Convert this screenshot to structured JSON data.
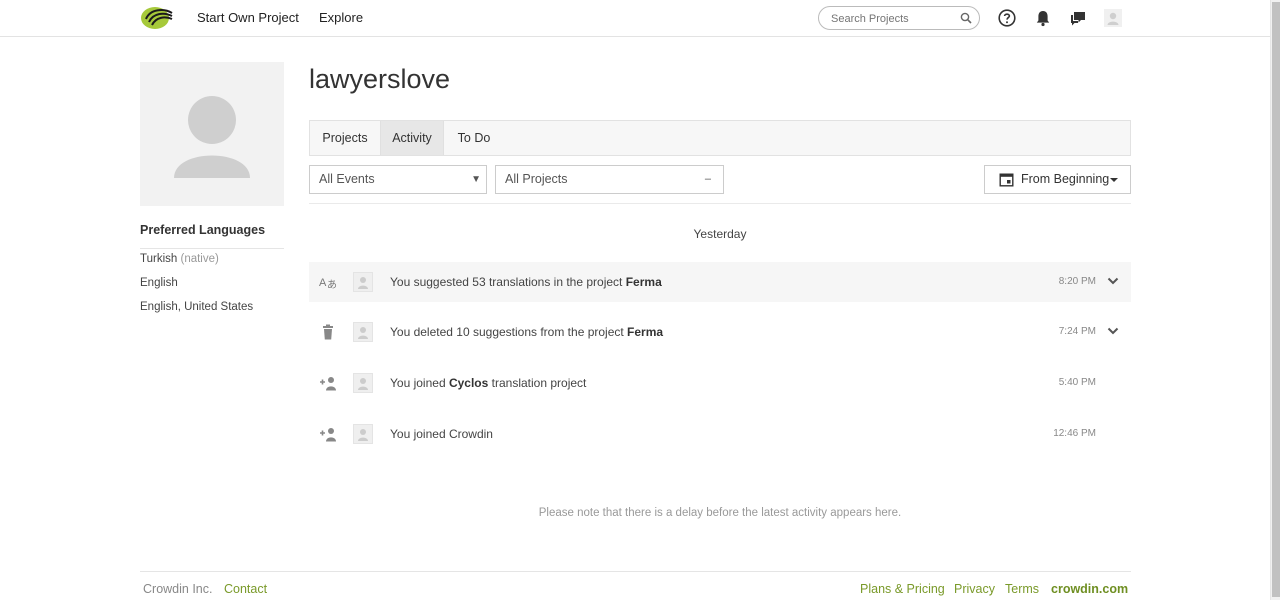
{
  "nav": {
    "start_project": "Start Own Project",
    "explore": "Explore",
    "search_placeholder": "Search Projects"
  },
  "icons": {
    "logo": "crowdin-logo",
    "search": "search-icon",
    "help": "help-icon",
    "notifications": "bell-icon",
    "messages": "chat-icon",
    "user": "user-avatar-icon"
  },
  "colors": {
    "brand_green": "#7a9a2a",
    "logo_green": "#a6c93a"
  },
  "profile": {
    "username": "lawyerslove",
    "preferred_languages_title": "Preferred Languages",
    "languages": [
      {
        "name": "Turkish",
        "note": "(native)"
      },
      {
        "name": "English",
        "note": ""
      },
      {
        "name": "English, United States",
        "note": ""
      }
    ]
  },
  "tabs": [
    {
      "label": "Projects"
    },
    {
      "label": "Activity"
    },
    {
      "label": "To Do"
    }
  ],
  "filters": {
    "events": "All Events",
    "projects": "All Projects",
    "date": "From Beginning"
  },
  "activity": {
    "day_label": "Yesterday",
    "items": [
      {
        "icon": "translate-icon",
        "pre": "You suggested 53 translations in the project ",
        "bold": "Ferma",
        "post": "",
        "time": "8:20 PM"
      },
      {
        "icon": "trash-icon",
        "pre": "You deleted 10 suggestions from the project ",
        "bold": "Ferma",
        "post": "",
        "time": "7:24 PM"
      },
      {
        "icon": "add-user-icon",
        "pre": "You joined ",
        "bold": "Cyclos",
        "post": " translation project",
        "time": "5:40 PM"
      },
      {
        "icon": "add-user-icon",
        "pre": "You joined Crowdin",
        "bold": "",
        "post": "",
        "time": "12:46 PM"
      }
    ],
    "note": "Please note that there is a delay before the latest activity appears here."
  },
  "footer": {
    "company": "Crowdin Inc.",
    "contact": "Contact",
    "plans": "Plans & Pricing",
    "privacy": "Privacy",
    "terms": "Terms",
    "brand": "crowdin.com"
  }
}
